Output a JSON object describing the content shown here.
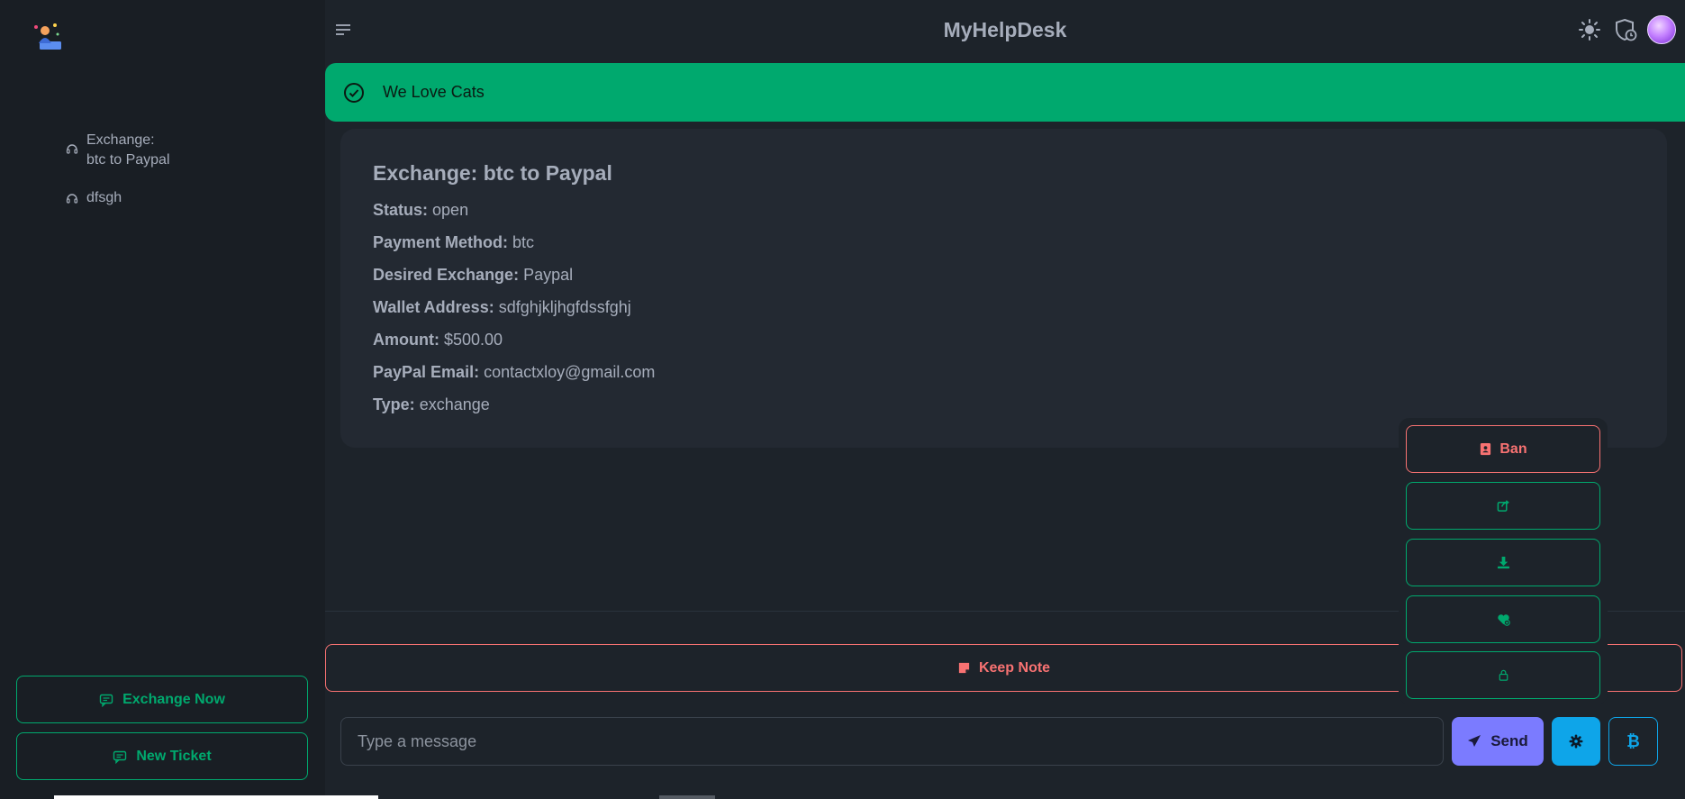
{
  "app": {
    "title": "MyHelpDesk"
  },
  "sidebar": {
    "tickets": [
      {
        "label": "Exchange:\nbtc to Paypal",
        "icon": "headset-icon"
      },
      {
        "label": "dfsgh",
        "icon": "headset-icon"
      }
    ],
    "exchange_now_label": "Exchange Now",
    "new_ticket_label": "New Ticket"
  },
  "alert": {
    "text": "We Love Cats",
    "icon": "check-circle-icon"
  },
  "ticket": {
    "title": "Exchange: btc to Paypal",
    "fields": [
      {
        "label": "Status:",
        "value": "open"
      },
      {
        "label": "Payment Method:",
        "value": "btc"
      },
      {
        "label": "Desired Exchange:",
        "value": "Paypal"
      },
      {
        "label": "Wallet Address:",
        "value": "sdfghjkljhgfdssfghj"
      },
      {
        "label": "Amount:",
        "value": "$500.00"
      },
      {
        "label": "PayPal Email:",
        "value": "contactxloy@gmail.com"
      },
      {
        "label": "Type:",
        "value": "exchange"
      }
    ]
  },
  "actions": {
    "ban_label": "Ban",
    "items": [
      "share-icon",
      "download-icon",
      "heart-plus-icon",
      "lock-icon"
    ]
  },
  "composer": {
    "keep_note_label": "Keep Note",
    "message_placeholder": "Type a message",
    "send_label": "Send",
    "btc_symbol": "₿"
  },
  "colors": {
    "accent_green": "#00a96e",
    "danger": "#f87272",
    "primary": "#7b7bff",
    "info": "#0ea5e9"
  }
}
